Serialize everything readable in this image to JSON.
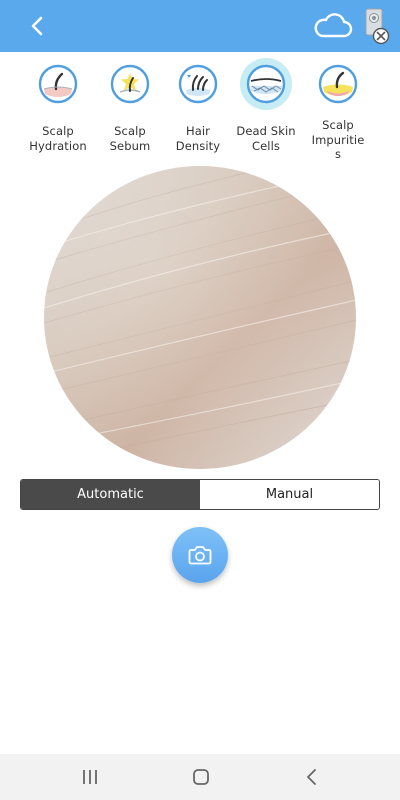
{
  "header": {
    "back_icon": "back-chevron-icon",
    "cloud_icon": "cloud-icon",
    "device_icon": "device-disconnected-icon",
    "background_color": "#5aa9ec"
  },
  "categories": [
    {
      "label": "Scalp\nHydration",
      "icon": "scalp-hydration-icon",
      "active": false
    },
    {
      "label": "Scalp\nSebum",
      "icon": "scalp-sebum-icon",
      "active": false
    },
    {
      "label": "Hair\nDensity",
      "icon": "hair-density-icon",
      "active": false
    },
    {
      "label": "Dead Skin\nCells",
      "icon": "dead-skin-cells-icon",
      "active": true
    },
    {
      "label": "Scalp\nImpuritie\ns",
      "icon": "scalp-impurities-icon",
      "active": false
    }
  ],
  "mode": {
    "automatic_label": "Automatic",
    "manual_label": "Manual",
    "selected": "Automatic"
  },
  "camera": {
    "icon": "camera-icon"
  },
  "system_nav": {
    "recents_icon": "recents-icon",
    "home_icon": "home-icon",
    "back_icon": "back-icon"
  }
}
